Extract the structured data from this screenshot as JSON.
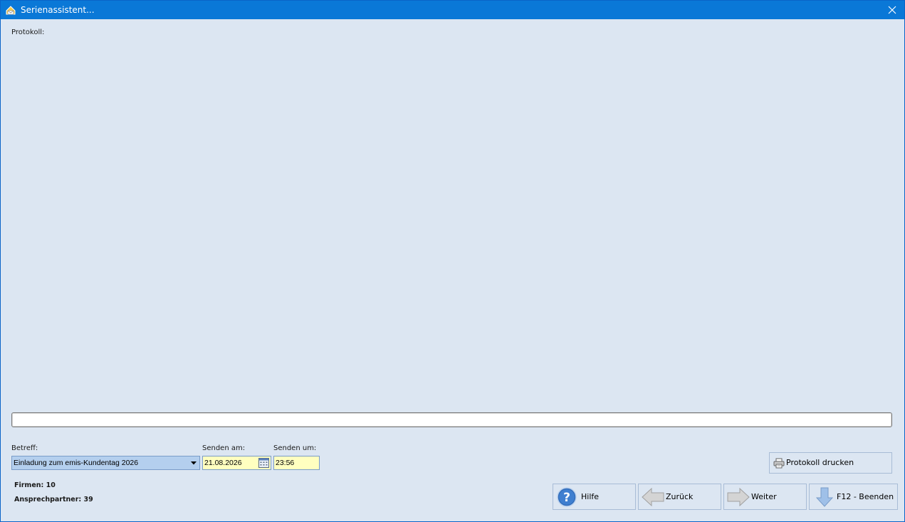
{
  "window": {
    "title": "Serienassistent...",
    "close_icon": "close-icon"
  },
  "protokoll": {
    "label": "Protokoll:"
  },
  "progress": {
    "value_percent": 0
  },
  "form": {
    "betreff_label": "Betreff:",
    "betreff_value": "Einladung zum emis-Kundentag 2026",
    "senden_am_label": "Senden am:",
    "senden_am_value": "21.08.2026",
    "senden_um_label": "Senden um:",
    "senden_um_value": "23:56"
  },
  "stats": {
    "firmen": "Firmen: 10",
    "ansprechpartner": "Ansprechpartner: 39"
  },
  "buttons": {
    "protokoll_drucken": {
      "label": "Protokoll drucken",
      "icon": "printer-icon"
    },
    "hilfe": {
      "label": "Hilfe",
      "icon": "help-icon"
    },
    "zurueck": {
      "label": "Zurück",
      "icon": "arrow-left-icon"
    },
    "weiter": {
      "label": "Weiter",
      "icon": "arrow-right-icon"
    },
    "beenden": {
      "label": "F12 - Beenden",
      "icon": "arrow-down-icon"
    }
  },
  "colors": {
    "titlebar": "#0a78d7",
    "background": "#dce6f2",
    "input_highlight": "#ffffc0",
    "combo_selected": "#b4cfee"
  }
}
